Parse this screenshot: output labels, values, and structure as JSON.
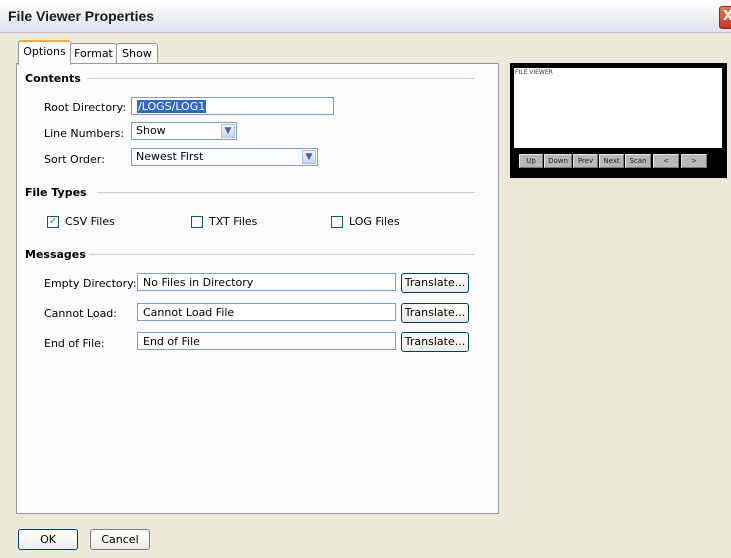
{
  "window": {
    "title": "File Viewer Properties",
    "close_glyph": "X"
  },
  "tabs": [
    {
      "label": "Options",
      "active": true
    },
    {
      "label": "Format",
      "active": false
    },
    {
      "label": "Show",
      "active": false
    }
  ],
  "contents": {
    "heading": "Contents",
    "root_directory": {
      "label": "Root Directory:",
      "value": "/LOGS/LOG1"
    },
    "line_numbers": {
      "label": "Line Numbers:",
      "value": "Show"
    },
    "sort_order": {
      "label": "Sort Order:",
      "value": "Newest First"
    }
  },
  "file_types": {
    "heading": "File Types",
    "items": [
      {
        "label": "CSV Files",
        "checked": true,
        "check_glyph": "✓"
      },
      {
        "label": "TXT Files",
        "checked": false
      },
      {
        "label": "LOG Files",
        "checked": false
      }
    ]
  },
  "messages": {
    "heading": "Messages",
    "rows": [
      {
        "label": "Empty Directory:",
        "value": "No Files in Directory",
        "button": "Translate..."
      },
      {
        "label": "Cannot Load:",
        "value": "Cannot Load File",
        "button": "Translate..."
      },
      {
        "label": "End of File:",
        "value": "End of File",
        "button": "Translate..."
      }
    ]
  },
  "footer": {
    "ok": "OK",
    "cancel": "Cancel"
  },
  "preview": {
    "screen_title": "FILE VIEWER",
    "buttons": [
      "Up",
      "Down",
      "Prev",
      "Next",
      "Scan",
      "<",
      ">"
    ]
  },
  "icons": {
    "dropdown": "chevron-down-icon",
    "close": "close-icon",
    "check": "checkmark-icon"
  },
  "colors": {
    "check": "#21a121",
    "selection": "#316ac5",
    "active_tab_accent": "#f7a93b"
  }
}
